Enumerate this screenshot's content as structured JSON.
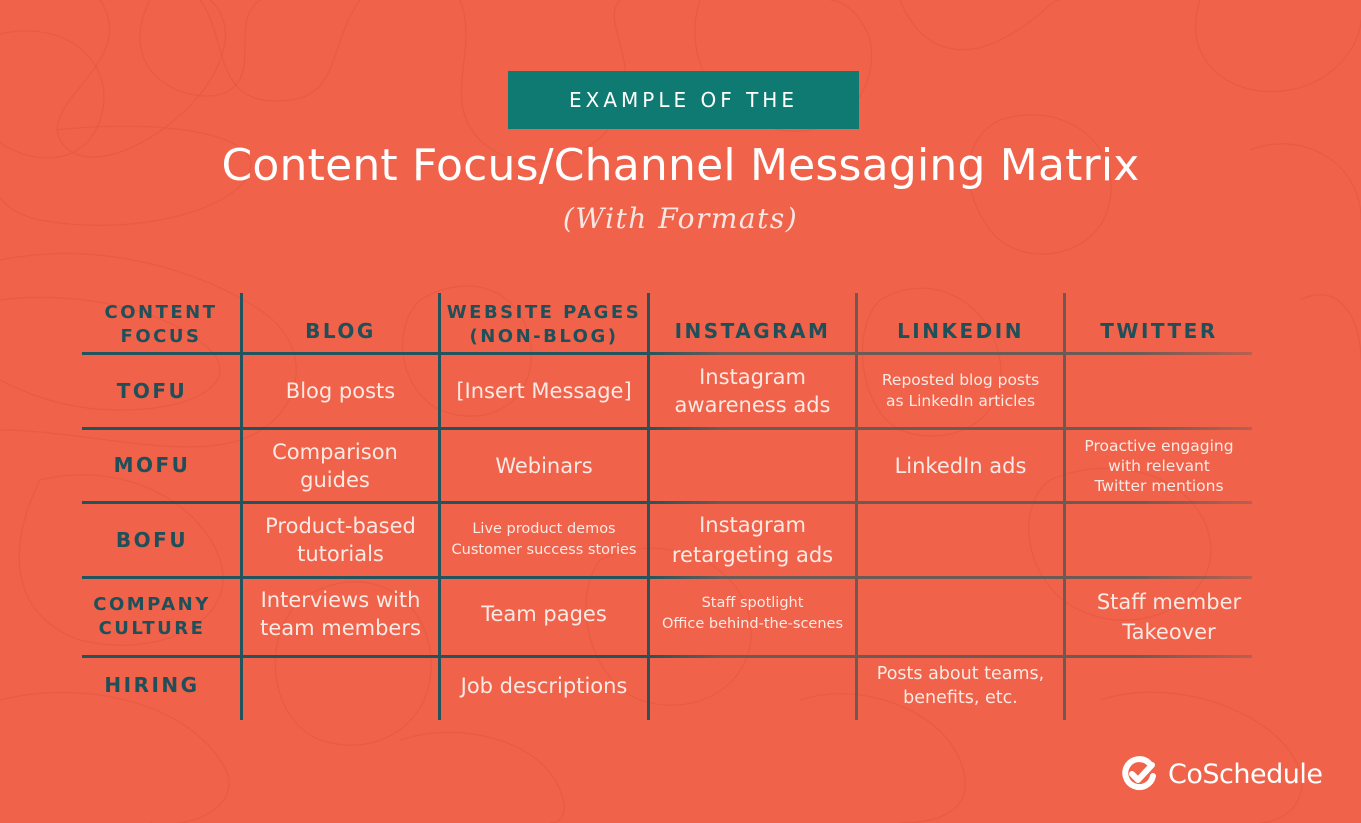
{
  "banner": {
    "label": "EXAMPLE OF THE"
  },
  "title": "Content Focus/Channel Messaging Matrix",
  "subtitle": "(With Formats)",
  "colors": {
    "background": "#f0624a",
    "banner": "#0e7a72",
    "header_text": "#1f4f58",
    "cell_text": "#fbe9e4",
    "grid_left": "#21545c",
    "grid_right": "#6d5a55"
  },
  "matrix": {
    "columns": [
      "CONTENT\nFOCUS",
      "BLOG",
      "WEBSITE PAGES\n(NON-BLOG)",
      "INSTAGRAM",
      "LINKEDIN",
      "TWITTER"
    ],
    "rows": [
      {
        "label": "TOFU",
        "cells": [
          "Blog posts",
          "[Insert Message]",
          "Instagram\nawareness ads",
          "Reposted blog posts\nas LinkedIn articles",
          ""
        ]
      },
      {
        "label": "MOFU",
        "cells": [
          "Comparison\nguides",
          "Webinars",
          "",
          "LinkedIn ads",
          "Proactive engaging\nwith relevant\nTwitter mentions"
        ]
      },
      {
        "label": "BOFU",
        "cells": [
          "Product-based\ntutorials",
          "Live product demos\nCustomer success stories",
          "Instagram\nretargeting ads",
          "",
          ""
        ]
      },
      {
        "label": "COMPANY\nCULTURE",
        "cells": [
          "Interviews with\nteam members",
          "Team pages",
          "Staff spotlight\nOffice behind-the-scenes",
          "",
          "Staff member\nTakeover"
        ]
      },
      {
        "label": "HIRING",
        "cells": [
          "",
          "Job descriptions",
          "",
          "Posts about teams,\nbenefits, etc.",
          ""
        ]
      }
    ]
  },
  "logo": {
    "icon": "coschedule-check-icon",
    "text": "CoSchedule"
  }
}
